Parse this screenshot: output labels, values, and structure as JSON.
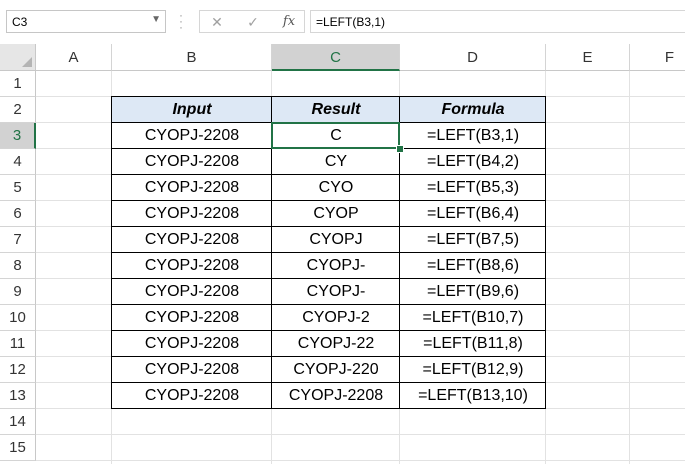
{
  "formula_bar": {
    "name_box": "C3",
    "formula": "=LEFT(B3,1)",
    "cancel_icon": "close-icon",
    "enter_icon": "check-icon",
    "function_icon": "fx-icon"
  },
  "columns": [
    "A",
    "B",
    "C",
    "D",
    "E",
    "F"
  ],
  "selected_column": "C",
  "rows": [
    "1",
    "2",
    "3",
    "4",
    "5",
    "6",
    "7",
    "8",
    "9",
    "10",
    "11",
    "12",
    "13",
    "14",
    "15"
  ],
  "selected_row": "3",
  "table": {
    "headers": [
      "Input",
      "Result",
      "Formula"
    ],
    "rows": [
      {
        "input": "CYOPJ-2208",
        "result": "C",
        "formula": "=LEFT(B3,1)"
      },
      {
        "input": "CYOPJ-2208",
        "result": "CY",
        "formula": "=LEFT(B4,2)"
      },
      {
        "input": "CYOPJ-2208",
        "result": "CYO",
        "formula": "=LEFT(B5,3)"
      },
      {
        "input": "CYOPJ-2208",
        "result": "CYOP",
        "formula": "=LEFT(B6,4)"
      },
      {
        "input": "CYOPJ-2208",
        "result": "CYOPJ",
        "formula": "=LEFT(B7,5)"
      },
      {
        "input": "CYOPJ-2208",
        "result": "CYOPJ-",
        "formula": "=LEFT(B8,6)"
      },
      {
        "input": "CYOPJ-2208",
        "result": "CYOPJ-",
        "formula": "=LEFT(B9,6)"
      },
      {
        "input": "CYOPJ-2208",
        "result": "CYOPJ-2",
        "formula": "=LEFT(B10,7)"
      },
      {
        "input": "CYOPJ-2208",
        "result": "CYOPJ-22",
        "formula": "=LEFT(B11,8)"
      },
      {
        "input": "CYOPJ-2208",
        "result": "CYOPJ-220",
        "formula": "=LEFT(B12,9)"
      },
      {
        "input": "CYOPJ-2208",
        "result": "CYOPJ-2208",
        "formula": "=LEFT(B13,10)"
      }
    ]
  },
  "colors": {
    "accent": "#217346",
    "header_fill": "#dde8f5"
  }
}
